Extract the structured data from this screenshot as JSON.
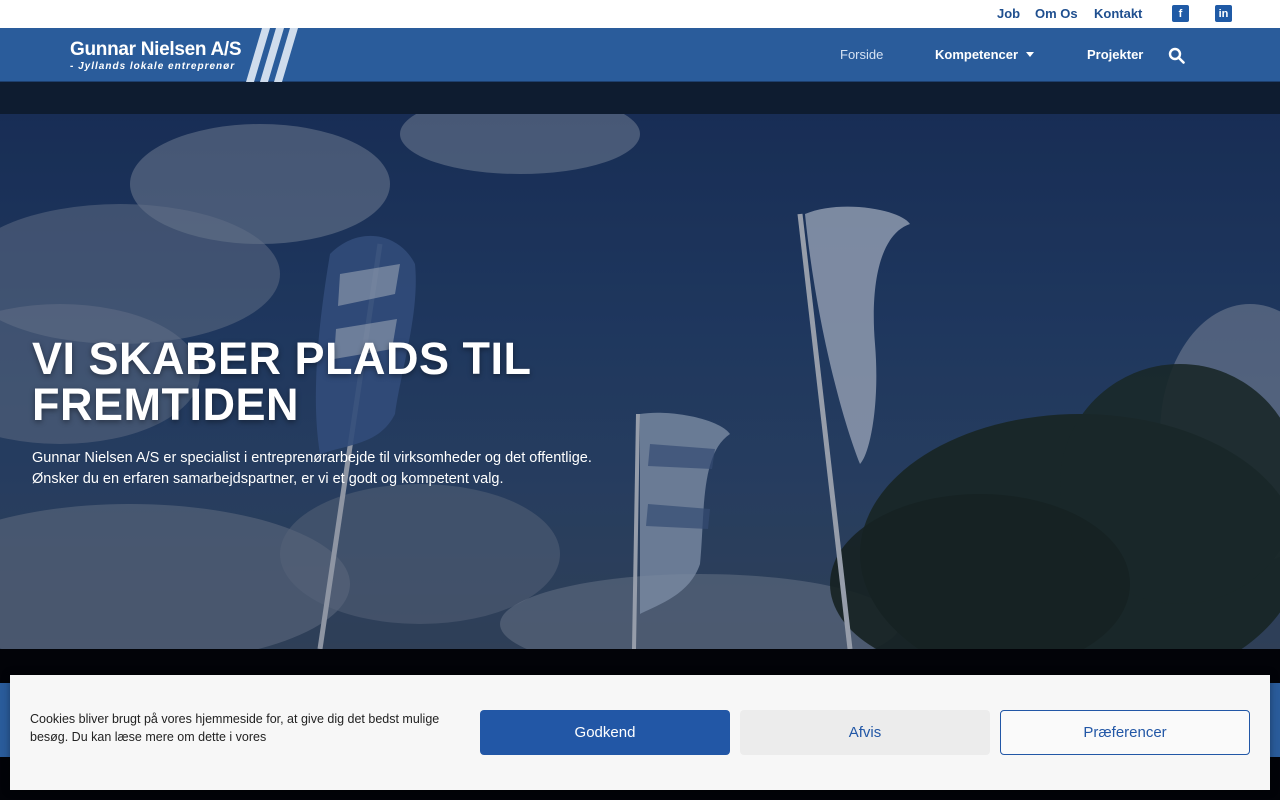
{
  "topbar": {
    "links": [
      "Job",
      "Om Os",
      "Kontakt"
    ],
    "facebook_icon": "facebook-icon",
    "linkedin_icon": "linkedin-icon"
  },
  "brand": {
    "name": "Gunnar Nielsen A/S",
    "tagline": "- Jyllands lokale entreprenør"
  },
  "nav": {
    "items": [
      "Forside",
      "Kompetencer",
      "Projekter"
    ],
    "search_icon": "search-icon",
    "dropdown_icon": "caret-down-icon"
  },
  "hero": {
    "title": "VI SKABER PLADS TIL FREMTIDEN",
    "line1": "Gunnar Nielsen A/S er specialist i entreprenørarbejde til virksomheder og det offentlige.",
    "line2": "Ønsker du en erfaren samarbejdspartner, er vi et godt og kompetent valg."
  },
  "cookie": {
    "text": "Cookies bliver brugt på vores hjemmeside for, at give dig det bedst mulige besøg. Du kan læse mere om dette i vores",
    "accept": "Godkend",
    "deny": "Afvis",
    "preferences": "Præferencer"
  },
  "colors": {
    "primary": "#2a5c9b",
    "accent": "#2257a6",
    "link": "#1f4f8f"
  }
}
